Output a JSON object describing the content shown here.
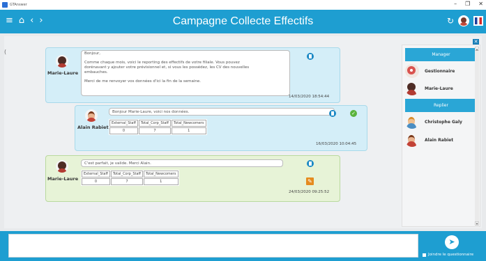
{
  "os": {
    "title": "GTAnswer",
    "minimize": "–",
    "maximize": "❐",
    "close": "✕"
  },
  "header": {
    "title": "Campagne Collecte Effectifs",
    "menu_icon": "≡",
    "home_icon": "⌂",
    "back_icon": "‹",
    "forward_icon": "›",
    "refresh_icon": "↻"
  },
  "main": {
    "close_label": "✕",
    "left_mark": "("
  },
  "messages": [
    {
      "sender": "Marie-Laure",
      "lines": [
        "Bonjour,",
        "",
        "Comme chaque mois, voici le reporting des effectifs de votre filiale. Vous pouvez",
        "dorénavant y ajouter votre prévisionnel et, si vous les possédez, les CV des nouvelles",
        "embauches.",
        "",
        "Merci de me renvoyer vos données d'ici la fin de la semaine."
      ],
      "timestamp": "14/03/2020 18:54:44"
    },
    {
      "sender": "Alain Rabiet",
      "text": "Bonjour Marie-Laure, voici nos données.",
      "headers": [
        "External_Staff",
        "Total_Corp_Staff",
        "Total_Newcomers"
      ],
      "values": [
        "0",
        "7",
        "1"
      ],
      "check_icon": "✓",
      "timestamp": "16/03/2020 10:04:45"
    },
    {
      "sender": "Marie-Laure",
      "text": "C'est parfait, je valide. Merci Alain.",
      "headers": [
        "External_Staff",
        "Total_Corp_Staff",
        "Total_Newcomers"
      ],
      "values": [
        "0",
        "7",
        "1"
      ],
      "edit_icon": "✎",
      "timestamp": "24/03/2020 09:25:52"
    }
  ],
  "panel": {
    "manager_title": "Manager",
    "managers": [
      {
        "name": "Gestionnaire"
      },
      {
        "name": "Marie-Laure"
      }
    ],
    "replier_title": "Replier",
    "repliers": [
      {
        "name": "Christophe Galy"
      },
      {
        "name": "Alain Rabiet"
      }
    ],
    "scroll_up": "▲",
    "scroll_down": "▼"
  },
  "composer": {
    "value": "",
    "send_icon": "➤",
    "attach_label": "Joindre le questionnaire"
  }
}
